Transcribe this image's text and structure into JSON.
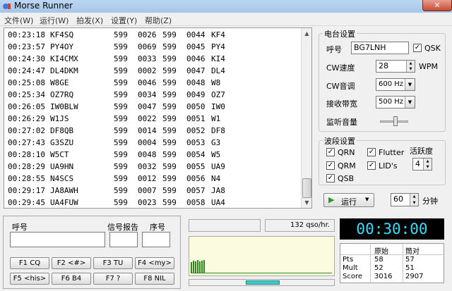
{
  "window": {
    "title": "Morse Runner",
    "close_glyph": "✕"
  },
  "menu": [
    "文件(W)",
    "运行(W)",
    "拍发(X)",
    "设置(Y)",
    "帮助(Z)"
  ],
  "log": [
    [
      "00:23:18",
      "KF4SQ",
      "599",
      "0026",
      "599",
      "0044",
      "KF4"
    ],
    [
      "00:23:57",
      "PY4OY",
      "599",
      "0069",
      "599",
      "0045",
      "PY4"
    ],
    [
      "00:24:30",
      "KI4CMX",
      "599",
      "0033",
      "599",
      "0046",
      "KI4"
    ],
    [
      "00:24:47",
      "DL4DKM",
      "599",
      "0002",
      "599",
      "0047",
      "DL4"
    ],
    [
      "00:25:08",
      "W8GE",
      "599",
      "0046",
      "599",
      "0048",
      "W8"
    ],
    [
      "00:25:34",
      "OZ7RQ",
      "599",
      "0034",
      "599",
      "0049",
      "OZ7"
    ],
    [
      "00:26:05",
      "IW0BLW",
      "599",
      "0047",
      "599",
      "0050",
      "IW0"
    ],
    [
      "00:26:29",
      "W1JS",
      "599",
      "0022",
      "599",
      "0051",
      "W1"
    ],
    [
      "00:27:02",
      "DF8QB",
      "599",
      "0014",
      "599",
      "0052",
      "DF8"
    ],
    [
      "00:27:43",
      "G3SZU",
      "599",
      "0004",
      "599",
      "0053",
      "G3"
    ],
    [
      "00:28:10",
      "W5CT",
      "599",
      "0048",
      "599",
      "0054",
      "W5"
    ],
    [
      "00:28:29",
      "UA9HN",
      "599",
      "0032",
      "599",
      "0055",
      "UA9"
    ],
    [
      "00:28:55",
      "N4SCS",
      "599",
      "0012",
      "599",
      "0056",
      "N4"
    ],
    [
      "00:29:17",
      "JA8AWH",
      "599",
      "0007",
      "599",
      "0057",
      "JA8"
    ],
    [
      "00:29:45",
      "UA4FUW",
      "599",
      "0023",
      "599",
      "0058",
      "UA4"
    ]
  ],
  "station": {
    "group_title": "电台设置",
    "call_label": "呼号",
    "call_value": "BG7LNH",
    "qsk_label": "QSK",
    "wpm_label": "CW速度",
    "wpm_value": "28",
    "wpm_unit": "WPM",
    "pitch_label": "CW音调",
    "pitch_value": "600 Hz",
    "bandwidth_label": "接收带宽",
    "bandwidth_value": "500 Hz",
    "monitor_label": "监听音量",
    "monitor_level": 0.55
  },
  "band": {
    "group_title": "波段设置",
    "qrn": "QRN",
    "qrm": "QRM",
    "qsb": "QSB",
    "flutter": "Flutter",
    "lids": "LID's",
    "activity_label": "活跃度",
    "activity_value": "4"
  },
  "run": {
    "label": "运行",
    "minutes_value": "60",
    "minutes_unit": "分钟"
  },
  "entry": {
    "call_label": "呼号",
    "rst_label": "信号报告",
    "nr_label": "序号",
    "buttons": [
      "F1 CQ",
      "F2 <#>",
      "F3 TU",
      "F4 <my>",
      "F5 <his>",
      "F6 B4",
      "F7 ?",
      "F8 NIL"
    ]
  },
  "rate": {
    "text": "132 qso/hr."
  },
  "timer": "00:30:00",
  "score": {
    "raw_header": "原始",
    "checked_header": "筒对",
    "rows": [
      {
        "label": "Pts",
        "raw": "58",
        "checked": "57"
      },
      {
        "label": "Mult",
        "raw": "52",
        "checked": "51"
      },
      {
        "label": "Score",
        "raw": "3016",
        "checked": "2907"
      }
    ]
  },
  "colors": {
    "timer_text": "#35e0ff",
    "bars": "#2a8a1a",
    "progress": "#40c8c8"
  }
}
